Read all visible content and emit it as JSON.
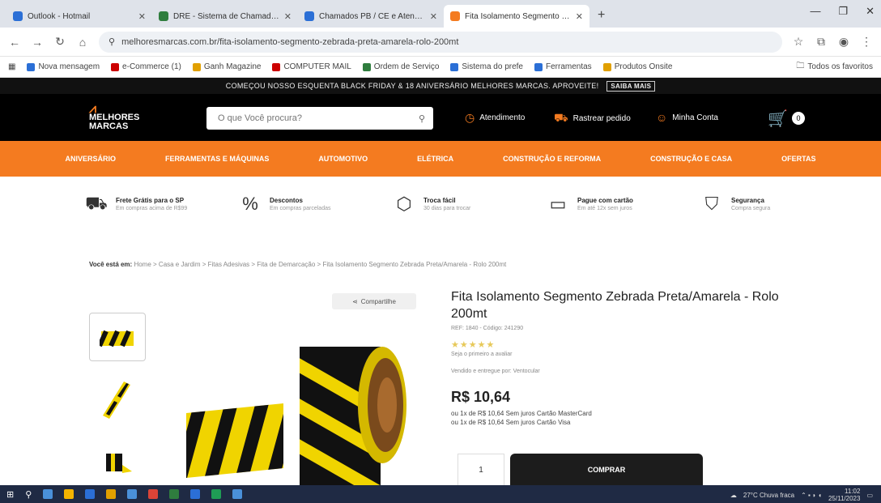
{
  "browser": {
    "tabs": [
      {
        "label": "Outlook - Hotmail",
        "color": "#2b6fd6"
      },
      {
        "label": "DRE - Sistema de Chamados",
        "color": "#2f7d3e"
      },
      {
        "label": "Chamados PB / CE e Atendimento",
        "color": "#2b6fd6"
      },
      {
        "label": "Fita Isolamento Segmento Ze...",
        "color": "#f47b20"
      }
    ],
    "url": "melhoresmarcas.com.br/fita-isolamento-segmento-zebrada-preta-amarela-rolo-200mt",
    "bookmarks": [
      {
        "label": "Nova mensagem",
        "color": "#2b6fd6"
      },
      {
        "label": "e-Commerce (1)",
        "color": "#c00"
      },
      {
        "label": "Ganh Magazine",
        "color": "#e1a000"
      },
      {
        "label": "COMPUTER MAIL",
        "color": "#c00"
      },
      {
        "label": "Ordem de Serviço",
        "color": "#2f7d3e"
      },
      {
        "label": "Sistema do prefe",
        "color": "#2b6fd6"
      },
      {
        "label": "Ferramentas",
        "color": "#2b6fd6"
      },
      {
        "label": "Produtos Onsite",
        "color": "#e1a000"
      }
    ],
    "bookmarks_other": "Todos os favoritos"
  },
  "promo": {
    "text": "COMEÇOU NOSSO ESQUENTA BLACK FRIDAY & 18 ANIVERSÁRIO MELHORES MARCAS. APROVEITE!",
    "cta": "SAIBA MAIS"
  },
  "header": {
    "logo_line1": "MELHORES",
    "logo_line2": "MARCAS",
    "search_placeholder": "O que Você procura?",
    "links": [
      "Atendimento",
      "Rastrear pedido",
      "Minha Conta"
    ],
    "cart_count": "0"
  },
  "nav": [
    "ANIVERSÁRIO",
    "FERRAMENTAS E MÁQUINAS",
    "AUTOMOTIVO",
    "ELÉTRICA",
    "CONSTRUÇÃO E REFORMA",
    "CONSTRUÇÃO E CASA",
    "OFERTAS"
  ],
  "benefits": [
    {
      "title": "Frete Grátis para o SP",
      "sub": "Em compras acima de R$99",
      "icon": "truck-icon",
      "glyph": "⛟"
    },
    {
      "title": "Descontos",
      "sub": "Em compras parceladas",
      "icon": "percent-icon",
      "glyph": "%"
    },
    {
      "title": "Troca fácil",
      "sub": "30 dias para trocar",
      "icon": "box-icon",
      "glyph": "⬡"
    },
    {
      "title": "Pague com cartão",
      "sub": "Em até 12x sem juros",
      "icon": "card-icon",
      "glyph": "▭"
    },
    {
      "title": "Segurança",
      "sub": "Compra segura",
      "icon": "shield-icon",
      "glyph": "⛉"
    }
  ],
  "breadcrumb": {
    "prefix": "Você está em:",
    "path": "Home > Casa e Jardim > Fitas Adesivas > Fita de Demarcação > Fita Isolamento Segmento Zebrada Preta/Amarela - Rolo 200mt"
  },
  "product": {
    "share": "Compartilhe",
    "title": "Fita Isolamento Segmento Zebrada Preta/Amarela - Rolo 200mt",
    "sku": "REF: 1840 - Código: 241290",
    "stars": "★★★★★",
    "reviews": "Seja o primeiro a avaliar",
    "seller": "Vendido e entregue por: Ventocular",
    "price": "R$ 10,64",
    "installment1": "ou 1x de R$ 10,64 Sem juros Cartão MasterCard",
    "installment2": "ou 1x de R$ 10,64 Sem juros Cartão Visa",
    "qty": "1",
    "buy": "COMPRAR"
  },
  "taskbar": {
    "weather": "27°C Chuva fraca",
    "time": "11:02",
    "date": "25/11/2023"
  }
}
